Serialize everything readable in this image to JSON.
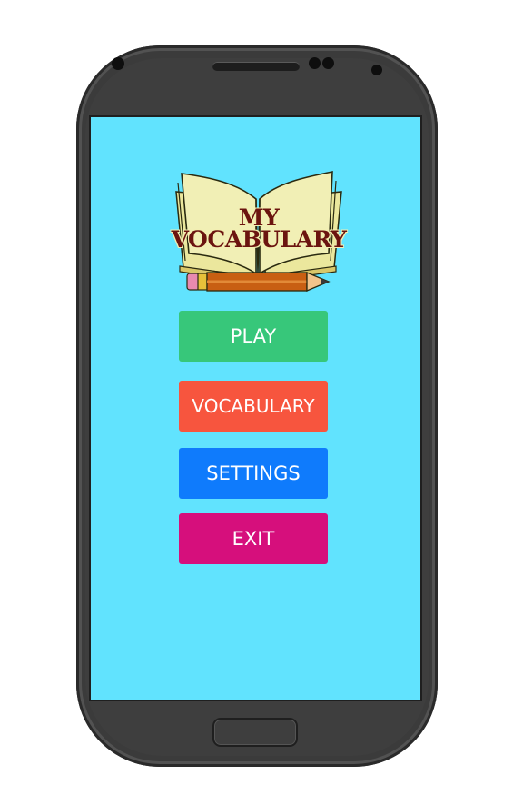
{
  "app": {
    "logo_line1": "MY",
    "logo_line2": "VOCABULARY"
  },
  "menu": {
    "play_label": "PLAY",
    "vocabulary_label": "VOCABULARY",
    "settings_label": "SETTINGS",
    "exit_label": "EXIT"
  },
  "colors": {
    "screen_background": "#61e3fe",
    "play_button": "#37c77a",
    "vocabulary_button": "#f7553e",
    "settings_button": "#0f7bfc",
    "exit_button": "#d60f7c",
    "logo_text": "#6b1410",
    "phone_body": "#3b3b3b"
  },
  "icons": {
    "logo": "open-book-pencil-icon",
    "camera": "camera-icon",
    "speaker": "speaker-grille-icon",
    "home": "home-button-icon"
  }
}
